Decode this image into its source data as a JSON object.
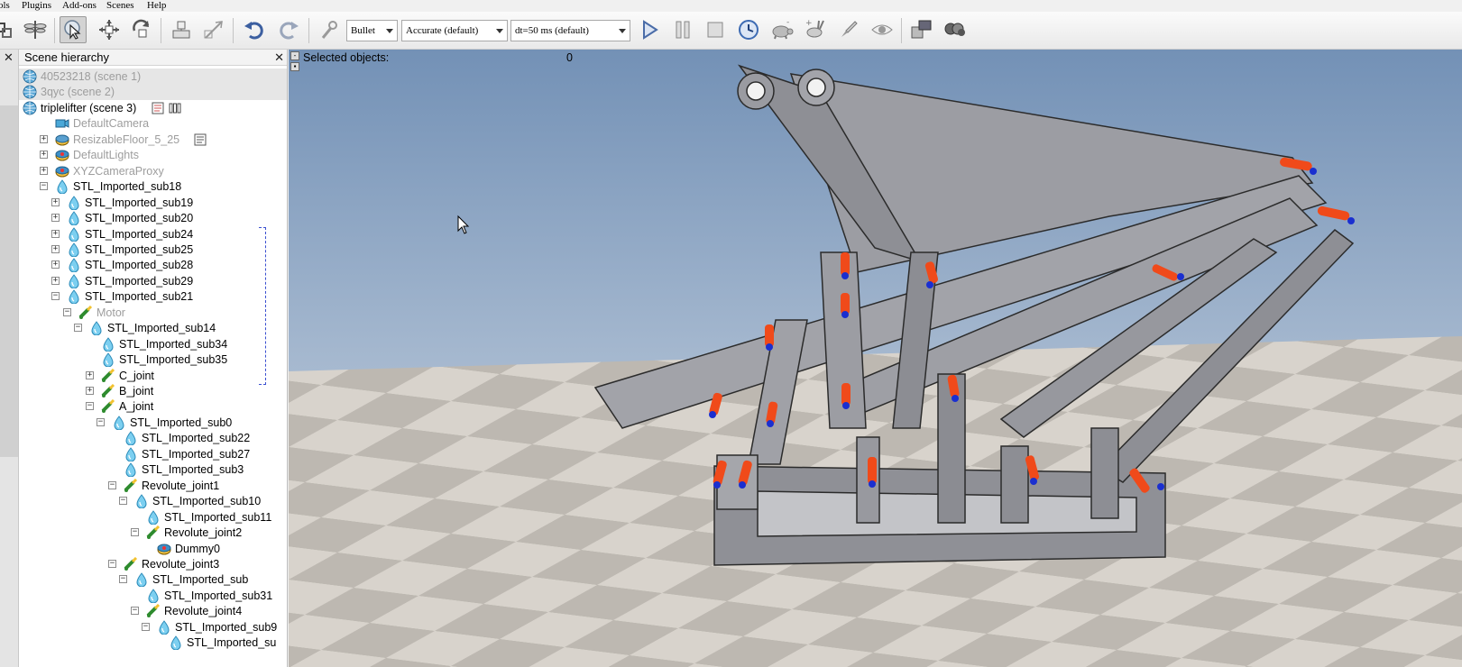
{
  "menu": {
    "items": [
      "ols",
      "Plugins",
      "Add-ons",
      "Scenes",
      "Help"
    ]
  },
  "toolbar": {
    "engine": "Bullet",
    "accuracy": "Accurate (default)",
    "timestep": "dt=50 ms (default)"
  },
  "hierarchy": {
    "title": "Scene hierarchy",
    "rows": [
      "40523218 (scene 1)",
      "3qyc (scene 2)",
      "triplelifter (scene 3)",
      "DefaultCamera",
      "ResizableFloor_5_25",
      "DefaultLights",
      "XYZCameraProxy",
      "STL_Imported_sub18",
      "STL_Imported_sub19",
      "STL_Imported_sub20",
      "STL_Imported_sub24",
      "STL_Imported_sub25",
      "STL_Imported_sub28",
      "STL_Imported_sub29",
      "STL_Imported_sub21",
      "Motor",
      "STL_Imported_sub14",
      "STL_Imported_sub34",
      "STL_Imported_sub35",
      "C_joint",
      "B_joint",
      "A_joint",
      "STL_Imported_sub0",
      "STL_Imported_sub22",
      "STL_Imported_sub27",
      "STL_Imported_sub3",
      "Revolute_joint1",
      "STL_Imported_sub10",
      "STL_Imported_sub11",
      "Revolute_joint2",
      "Dummy0",
      "Revolute_joint3",
      "STL_Imported_sub",
      "STL_Imported_sub31",
      "Revolute_joint4",
      "STL_Imported_sub9",
      "STL_Imported_su"
    ]
  },
  "viewport": {
    "selected_label": "Selected objects:",
    "selected_count": "0"
  }
}
